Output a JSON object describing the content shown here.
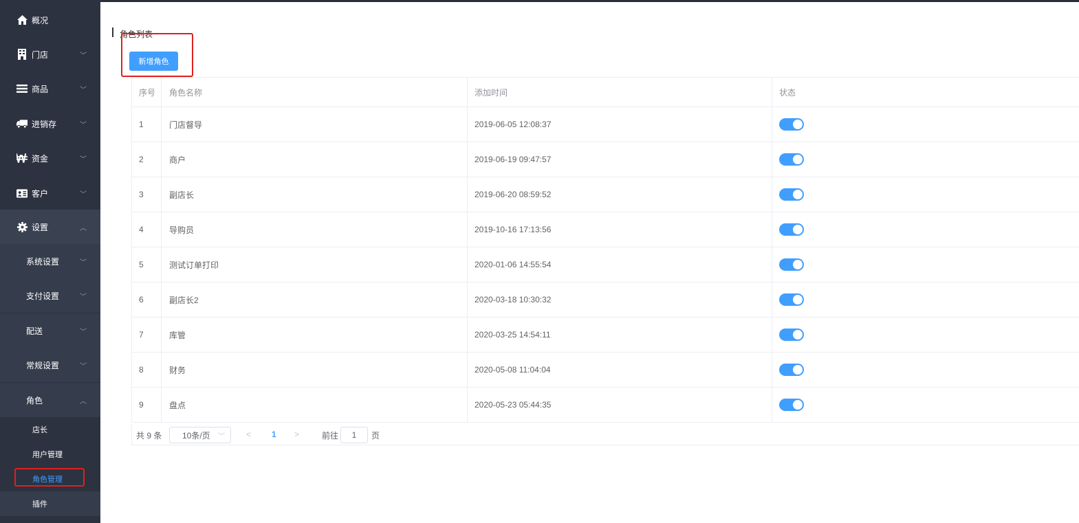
{
  "sidebar": {
    "items": [
      {
        "label": "概况",
        "icon": "home-icon"
      },
      {
        "label": "门店",
        "icon": "building-icon"
      },
      {
        "label": "商品",
        "icon": "list-icon"
      },
      {
        "label": "进销存",
        "icon": "truck-icon"
      },
      {
        "label": "资金",
        "icon": "won-icon"
      },
      {
        "label": "客户",
        "icon": "id-card-icon"
      },
      {
        "label": "设置",
        "icon": "gear-icon"
      }
    ],
    "settings_sub": [
      "系统设置",
      "支付设置",
      "配送",
      "常规设置",
      "角色"
    ],
    "role_leaves": [
      "店长",
      "用户管理",
      "角色管理"
    ],
    "plugin_label": "插件",
    "chevron_down": "﹀",
    "chevron_up": "︿"
  },
  "main": {
    "title": "角色列表",
    "add_button": "新增角色",
    "columns": [
      "序号",
      "角色名称",
      "添加时间",
      "状态"
    ],
    "rows": [
      {
        "no": "1",
        "name": "门店督导",
        "time": "2019-06-05 12:08:37",
        "enabled": true
      },
      {
        "no": "2",
        "name": "商户",
        "time": "2019-06-19 09:47:57",
        "enabled": true
      },
      {
        "no": "3",
        "name": "副店长",
        "time": "2019-06-20 08:59:52",
        "enabled": true
      },
      {
        "no": "4",
        "name": "导购员",
        "time": "2019-10-16 17:13:56",
        "enabled": true
      },
      {
        "no": "5",
        "name": "测试订单打印",
        "time": "2020-01-06 14:55:54",
        "enabled": true
      },
      {
        "no": "6",
        "name": "副店长2",
        "time": "2020-03-18 10:30:32",
        "enabled": true
      },
      {
        "no": "7",
        "name": "库管",
        "time": "2020-03-25 14:54:11",
        "enabled": true
      },
      {
        "no": "8",
        "name": "财务",
        "time": "2020-05-08 11:04:04",
        "enabled": true
      },
      {
        "no": "9",
        "name": "盘点",
        "time": "2020-05-23 05:44:35",
        "enabled": true
      }
    ],
    "pagination": {
      "total": "共 9 条",
      "page_size": "10条/页",
      "prev": "<",
      "current": "1",
      "next": ">",
      "goto_label": "前往",
      "goto_value": "1",
      "page_unit": "页"
    }
  },
  "colors": {
    "accent": "#409eff",
    "sidebar": "#2c3240",
    "highlight": "#e0201e"
  }
}
